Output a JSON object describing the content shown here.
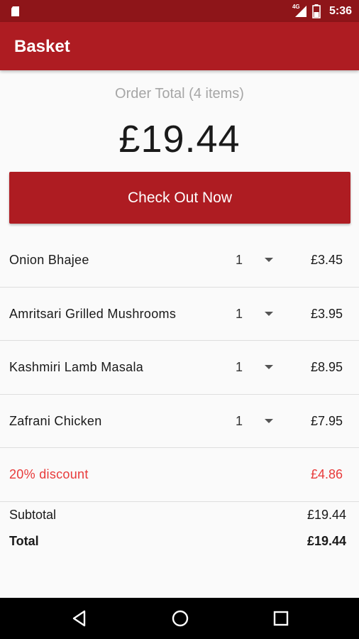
{
  "status_bar": {
    "network_label": "4G",
    "time": "5:36"
  },
  "app_bar": {
    "title": "Basket"
  },
  "summary": {
    "order_label": "Order Total (4 items)",
    "order_total": "£19.44"
  },
  "checkout": {
    "label": "Check Out Now"
  },
  "items": [
    {
      "name": "Onion Bhajee",
      "qty": "1",
      "price": "£3.45"
    },
    {
      "name": "Amritsari Grilled Mushrooms",
      "qty": "1",
      "price": "£3.95"
    },
    {
      "name": "Kashmiri Lamb Masala",
      "qty": "1",
      "price": "£8.95"
    },
    {
      "name": "Zafrani Chicken",
      "qty": "1",
      "price": "£7.95"
    }
  ],
  "discount": {
    "label": "20% discount",
    "amount": "£4.86"
  },
  "totals": {
    "subtotal_label": "Subtotal",
    "subtotal_value": "£19.44",
    "total_label": "Total",
    "total_value": "£19.44"
  },
  "colors": {
    "status_bar": "#8e1519",
    "brand_red": "#ae1c22",
    "discount_red": "#e83a3a"
  },
  "icons": {
    "status": [
      "sd-card-icon",
      "signal-icon",
      "battery-icon"
    ],
    "nav": [
      "back-icon",
      "home-icon",
      "recents-icon"
    ]
  }
}
